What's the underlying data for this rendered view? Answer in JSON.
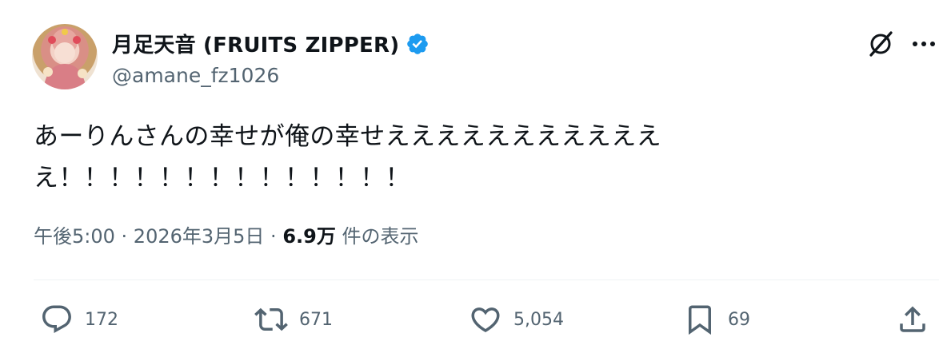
{
  "author": {
    "display_name": "月足天音 (FRUITS ZIPPER)",
    "handle": "@amane_fz1026"
  },
  "tweet": {
    "line1": "あーりんさんの幸せが俺の幸せえええええええええええ",
    "line2": "え！！！！！！！！！！！！！！"
  },
  "meta": {
    "time": "午後5:00",
    "sep1": " · ",
    "date": "2026年3月5日",
    "sep2": " · ",
    "views": "6.9万",
    "views_label": " 件の表示"
  },
  "actions": {
    "replies": "172",
    "reposts": "671",
    "likes": "5,054",
    "bookmarks": "69"
  },
  "icons": {
    "verified": "verified-badge-icon",
    "grok": "grok-icon",
    "more": "more-options-icon",
    "reply": "reply-icon",
    "repost": "repost-icon",
    "like": "heart-icon",
    "bookmark": "bookmark-icon",
    "share": "share-icon"
  },
  "colors": {
    "verified": "#1d9bf0",
    "text": "#0f1419",
    "secondary": "#536471"
  }
}
